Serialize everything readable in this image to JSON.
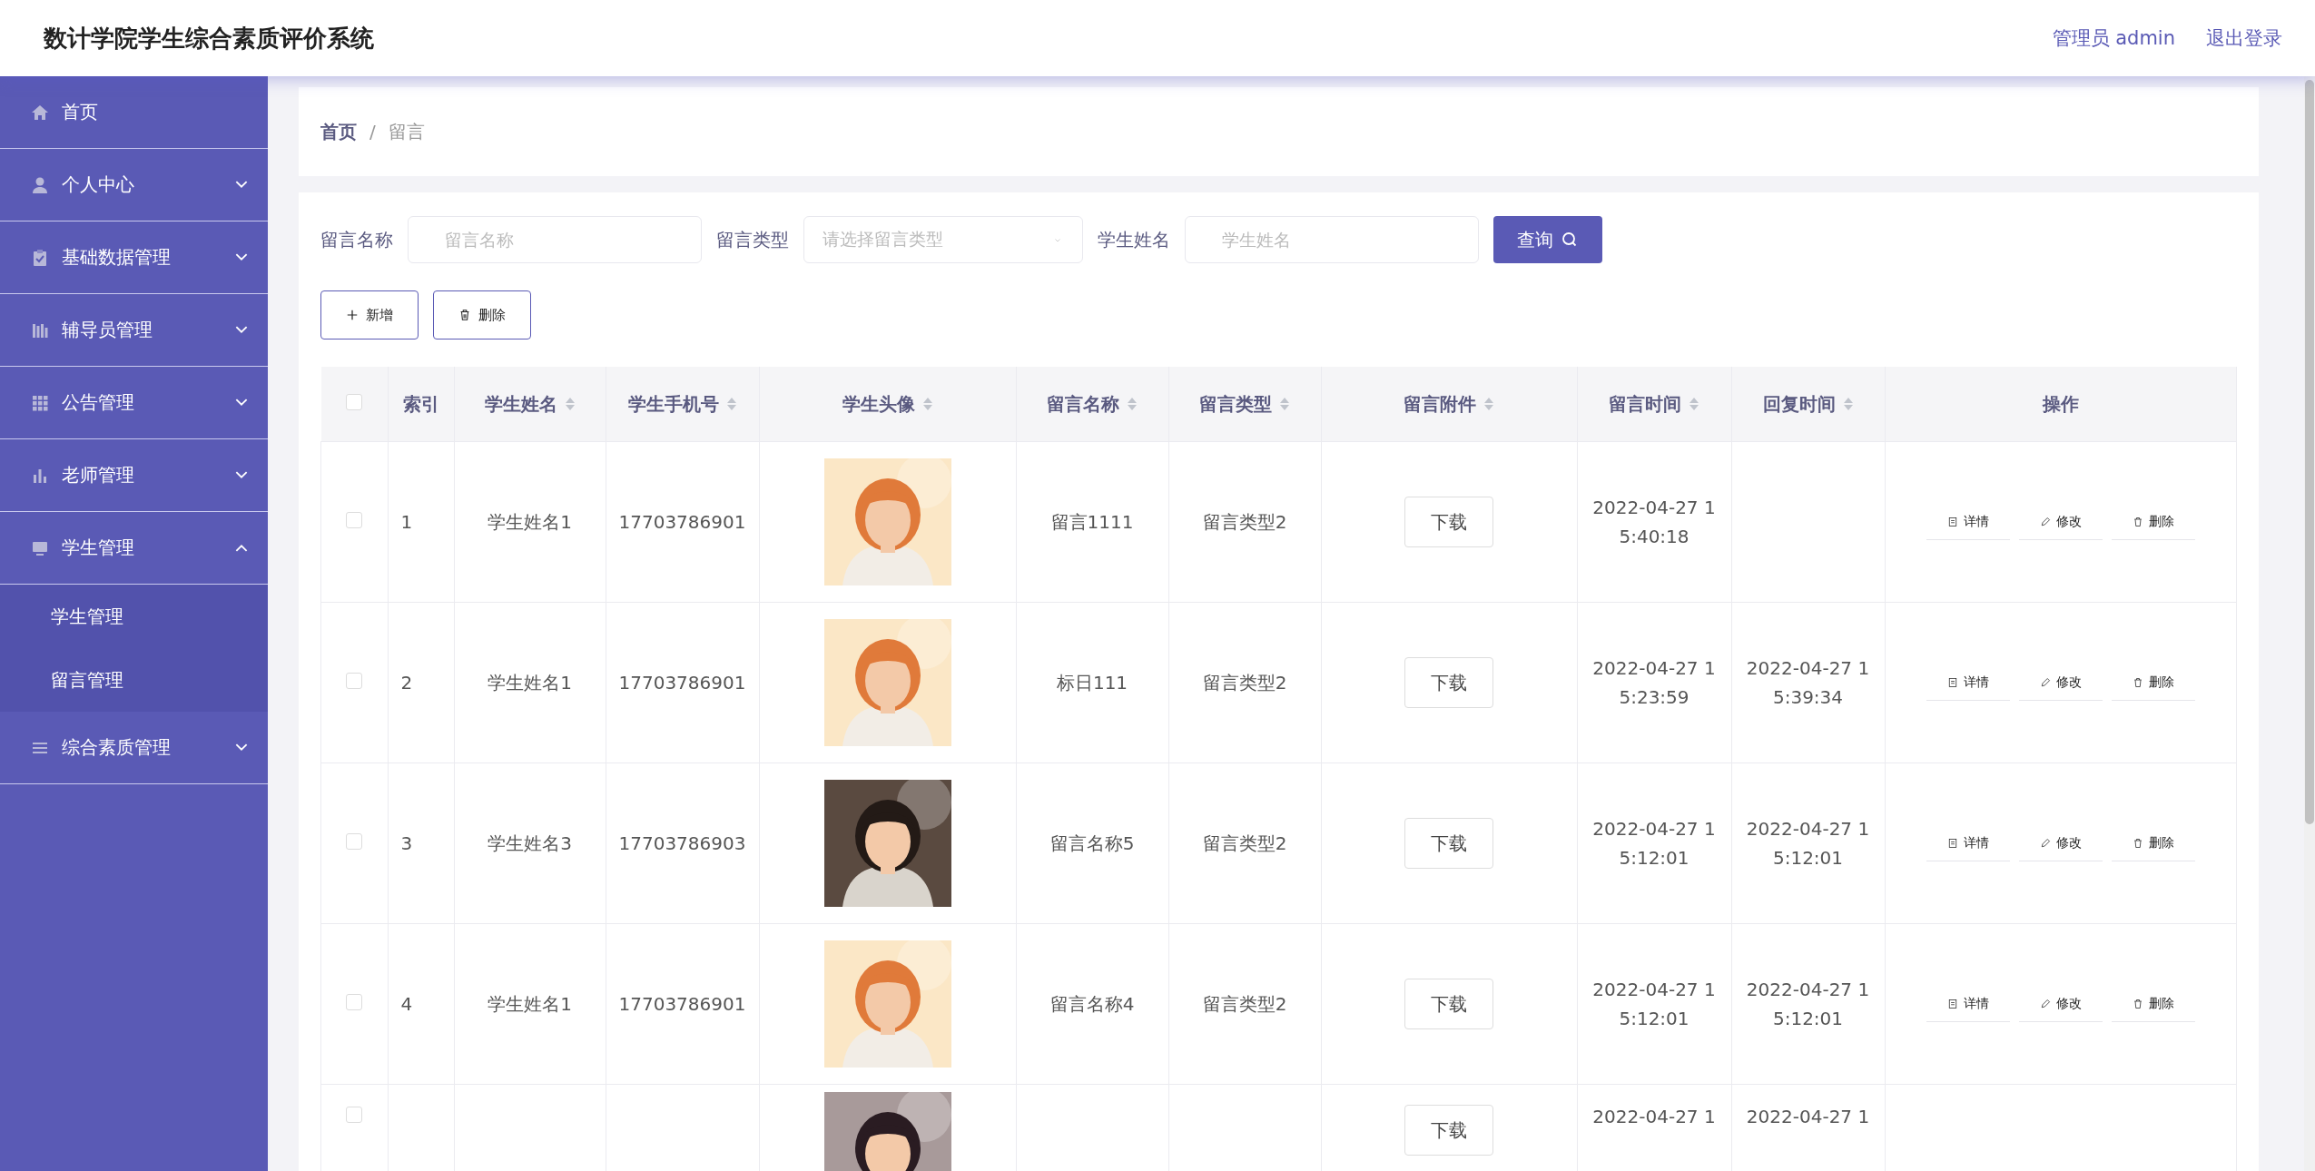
{
  "header": {
    "title": "数计学院学生综合素质评价系统",
    "user": "管理员 admin",
    "logout": "退出登录"
  },
  "sidebar": {
    "items": [
      {
        "label": "首页"
      },
      {
        "label": "个人中心",
        "expanded": false
      },
      {
        "label": "基础数据管理",
        "expanded": false
      },
      {
        "label": "辅导员管理",
        "expanded": false
      },
      {
        "label": "公告管理",
        "expanded": false
      },
      {
        "label": "老师管理",
        "expanded": false
      },
      {
        "label": "学生管理",
        "expanded": true,
        "children": [
          {
            "label": "学生管理"
          },
          {
            "label": "留言管理"
          }
        ]
      },
      {
        "label": "综合素质管理",
        "expanded": false
      }
    ]
  },
  "breadcrumb": {
    "items": [
      "首页",
      "留言"
    ],
    "separator": "/"
  },
  "search": {
    "fields": [
      {
        "kind": "text",
        "label": "留言名称",
        "placeholder": "留言名称"
      },
      {
        "kind": "select",
        "label": "留言类型",
        "placeholder": "请选择留言类型"
      },
      {
        "kind": "text",
        "label": "学生姓名",
        "placeholder": "学生姓名"
      }
    ],
    "button": "查询"
  },
  "actions": [
    {
      "kind": "add",
      "label": "新增"
    },
    {
      "kind": "delete",
      "label": "删除"
    }
  ],
  "table": {
    "all_checked": false,
    "columns": [
      {
        "label": "索引",
        "sortable": false
      },
      {
        "label": "学生姓名",
        "sortable": true
      },
      {
        "label": "学生手机号",
        "sortable": true
      },
      {
        "label": "学生头像",
        "sortable": true
      },
      {
        "label": "留言名称",
        "sortable": true
      },
      {
        "label": "留言类型",
        "sortable": true
      },
      {
        "label": "留言附件",
        "sortable": true
      },
      {
        "label": "留言时间",
        "sortable": true
      },
      {
        "label": "回复时间",
        "sortable": true
      },
      {
        "label": "操作",
        "sortable": false
      }
    ],
    "rows": [
      {
        "checked": false,
        "index": "1",
        "name": "学生姓名1",
        "phone": "17703786901",
        "title": "留言1111",
        "type": "留言类型2",
        "file": "下载",
        "time": "2022-04-27 15:40:18",
        "ops": [
          "详情",
          "修改",
          "删除"
        ]
      },
      {
        "checked": false,
        "index": "2",
        "name": "学生姓名1",
        "phone": "17703786901",
        "title": "标日111",
        "type": "留言类型2",
        "file": "下载",
        "time": "2022-04-27 15:23:59",
        "reply": "2022-04-27 15:39:34",
        "ops": [
          "详情",
          "修改",
          "删除"
        ]
      },
      {
        "checked": false,
        "index": "3",
        "name": "学生姓名3",
        "phone": "17703786903",
        "title": "留言名称5",
        "type": "留言类型2",
        "file": "下载",
        "time": "2022-04-27 15:12:01",
        "reply": "2022-04-27 15:12:01",
        "ops": [
          "详情",
          "修改",
          "删除"
        ]
      },
      {
        "checked": false,
        "index": "4",
        "name": "学生姓名1",
        "phone": "17703786901",
        "title": "留言名称4",
        "type": "留言类型2",
        "file": "下载",
        "time": "2022-04-27 15:12:01",
        "reply": "2022-04-27 15:12:01",
        "ops": [
          "详情",
          "修改",
          "删除"
        ]
      },
      {
        "checked": false,
        "file": "下载",
        "time": "2022-04-27 1",
        "reply": "2022-04-27 1"
      }
    ]
  }
}
